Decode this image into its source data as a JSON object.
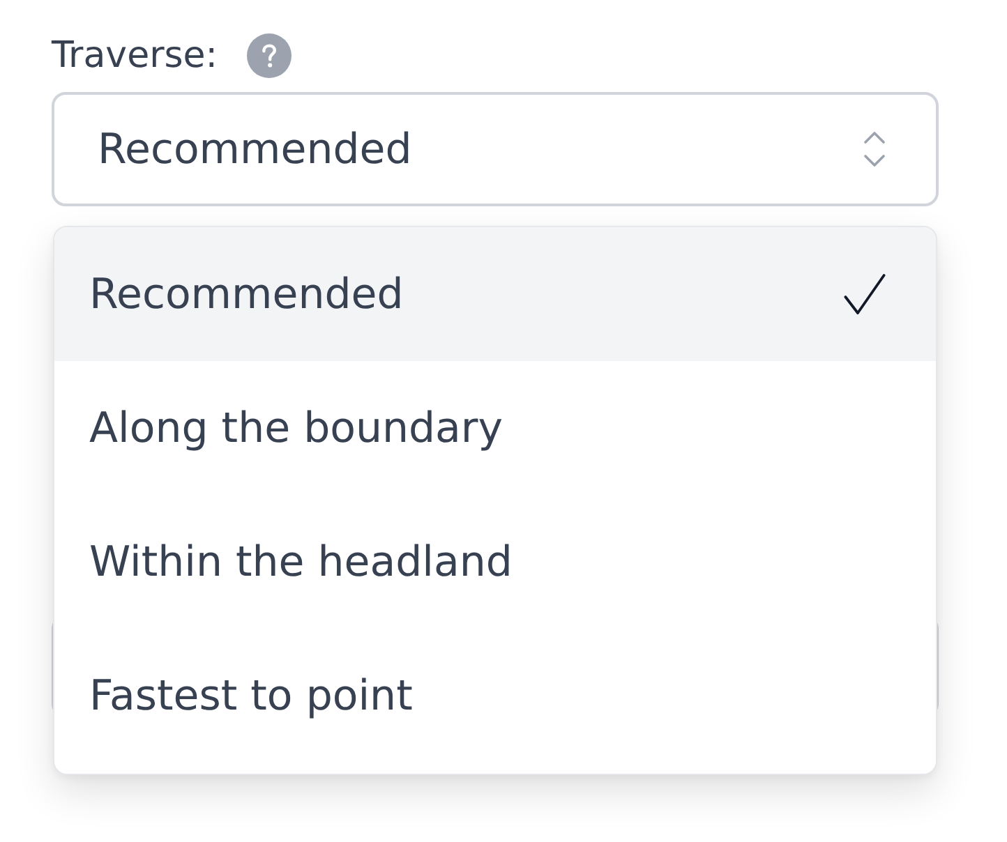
{
  "field": {
    "label": "Traverse:",
    "value": "Recommended"
  },
  "options": [
    {
      "label": "Recommended",
      "selected": true
    },
    {
      "label": "Along the boundary",
      "selected": false
    },
    {
      "label": "Within the headland",
      "selected": false
    },
    {
      "label": "Fastest to point",
      "selected": false
    }
  ]
}
